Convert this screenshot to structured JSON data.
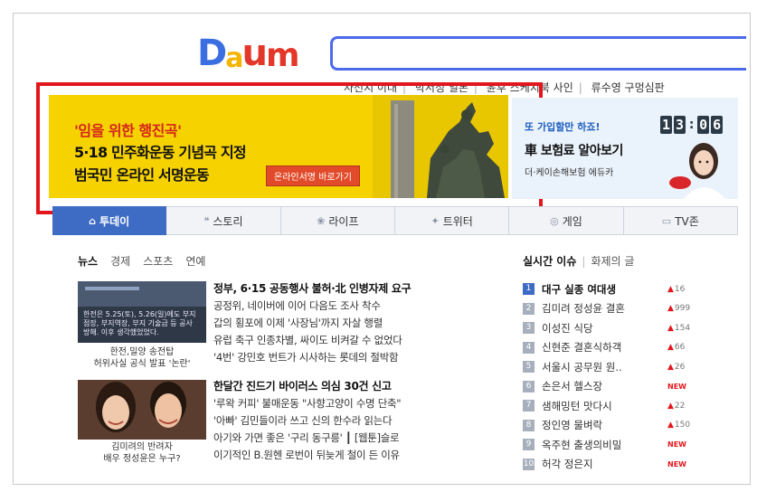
{
  "logo": {
    "text": [
      "D",
      "a",
      "u",
      "m"
    ],
    "colors": [
      "#3b6ee0",
      "#f5b400",
      "#e3372a",
      "#e3372a"
    ]
  },
  "search": {
    "value": "",
    "accent": "#4d6be8"
  },
  "hotlinks": [
    "자선지 이대",
    "박서정 일본",
    "윤후 스케치북 사인",
    "류수영 구멍심판"
  ],
  "banner": {
    "quote": "'임을 위한 행진곡'",
    "line2": "5·18 민주화운동 기념곡 지정",
    "line3": "범국민 온라인 서명운동",
    "cta": "온라인서명 바로가기"
  },
  "ad_right": {
    "line1": "또 가입할만 하죠!",
    "line2": "車 보험료 알아보기",
    "line3": "더·케이손해보험 에듀카",
    "clock": [
      "1",
      "3",
      "0",
      "6"
    ]
  },
  "tabs": [
    {
      "label": "투데이",
      "icon": "home-icon",
      "glyph": "⌂",
      "active": true
    },
    {
      "label": "스토리",
      "icon": "story-icon",
      "glyph": "❝",
      "active": false
    },
    {
      "label": "라이프",
      "icon": "life-icon",
      "glyph": "❀",
      "active": false
    },
    {
      "label": "트위터",
      "icon": "twitter-icon",
      "glyph": "✦",
      "active": false
    },
    {
      "label": "게임",
      "icon": "gamepad-icon",
      "glyph": "◎",
      "active": false
    },
    {
      "label": "TV존",
      "icon": "tv-icon",
      "glyph": "▭",
      "active": false
    }
  ],
  "news_tabs": [
    "뉴스",
    "경제",
    "스포츠",
    "연예"
  ],
  "thumbs": [
    {
      "overlay": "한전은 5.25(토), 5.26(일)에도 부지점장, 부지역장, 부지 기술급 등 공사 방해. 이후 생각했었었다.",
      "caption": [
        "한전,밀양 송전탑",
        "허위사실 공식 발표 '논란'"
      ]
    },
    {
      "caption": [
        "김미려의 반려자",
        "배우 정성윤은 누구?"
      ]
    }
  ],
  "news_groups": [
    {
      "headline": "정부, 6·15 공동행사 불허·北 인병자제 요구",
      "items": [
        "공정위, 네이버에 이어 다음도 조사 착수",
        "갑의 횡포에 이제 '사장님'까지 자살 행렬",
        "유럽 축구 인종차별, 싸이도 비켜갈 수 없었다",
        "'4번' 강민호 번트가 시사하는 롯데의 절박함"
      ]
    },
    {
      "headline": "한달간 진드기 바이러스 의심 30건 신고",
      "items": [
        "'루왁 커피' 불매운동 \"사향고양이 수명 단축\"",
        "'아빠' 김민들이라 쓰고 신의 한수라 읽는다",
        "아기와 가면 좋은 '구리 동구릉' ┃ [웹툰]슬로",
        "이기적인 B.원헨 로번이 뒤늦게 철이 든 이유"
      ]
    }
  ],
  "realtime": {
    "title": "실시간 이슈",
    "alt": "화제의 글",
    "items": [
      {
        "rank": "1",
        "keyword": "대구 실종 여대생",
        "change": "16",
        "trend": "up"
      },
      {
        "rank": "2",
        "keyword": "김미려 정성윤 결혼",
        "change": "999",
        "trend": "up"
      },
      {
        "rank": "3",
        "keyword": "이성진 식당",
        "change": "154",
        "trend": "up"
      },
      {
        "rank": "4",
        "keyword": "신현준 결혼식하객",
        "change": "66",
        "trend": "up"
      },
      {
        "rank": "5",
        "keyword": "서울시 공무원 원..",
        "change": "26",
        "trend": "up"
      },
      {
        "rank": "6",
        "keyword": "손은서 헬스장",
        "change": "NEW",
        "trend": "new"
      },
      {
        "rank": "7",
        "keyword": "샘해밍턴 맛다시",
        "change": "22",
        "trend": "up"
      },
      {
        "rank": "8",
        "keyword": "정인영 물벼락",
        "change": "150",
        "trend": "up"
      },
      {
        "rank": "9",
        "keyword": "옥주현 출생의비밀",
        "change": "NEW",
        "trend": "new"
      },
      {
        "rank": "10",
        "keyword": "허각 정은지",
        "change": "NEW",
        "trend": "new"
      }
    ]
  },
  "colors": {
    "tab_active": "#3e6bc4",
    "banner_bg": "#f6d200",
    "highlight": "#e4161d",
    "trend_up": "#e4161d"
  }
}
